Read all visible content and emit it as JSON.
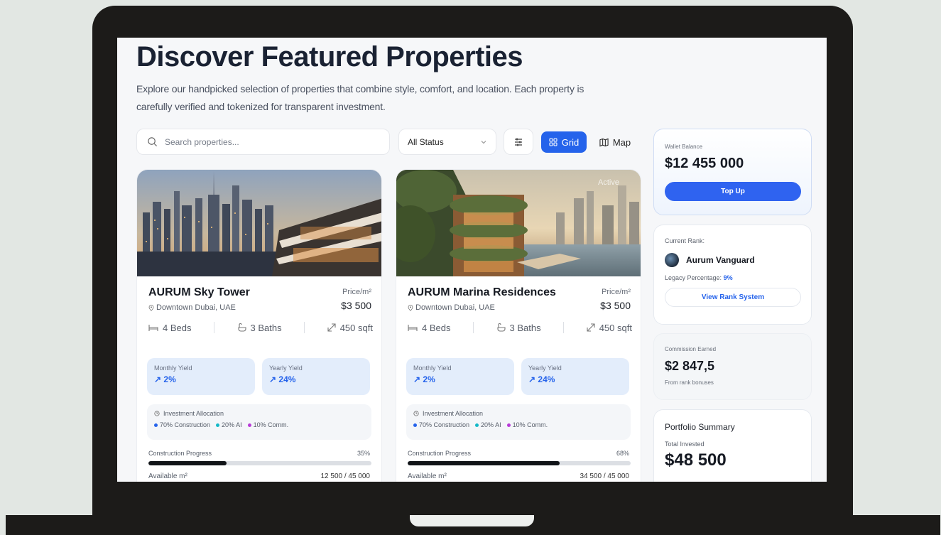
{
  "page": {
    "title": "Discover Featured Properties",
    "subtitle": "Explore our handpicked selection of properties that combine style, comfort, and location. Each property is carefully verified and tokenized for transparent investment."
  },
  "toolbar": {
    "search_placeholder": "Search properties...",
    "status_value": "All Status",
    "grid_label": "Grid",
    "map_label": "Map"
  },
  "cards": [
    {
      "name": "AURUM Sky Tower",
      "location": "Downtown Dubai, UAE",
      "price_label": "Price/m²",
      "price": "$3 500",
      "beds": "4 Beds",
      "baths": "3 Baths",
      "area": "450 sqft",
      "monthly_label": "Monthly Yield",
      "monthly_value": "2%",
      "yearly_label": "Yearly Yield",
      "yearly_value": "24%",
      "alloc_title": "Investment Allocation",
      "alloc_construction": "70% Construction",
      "alloc_ai": "20% AI",
      "alloc_comm": "10% Comm.",
      "progress_label": "Construction Progress",
      "progress_pct": "35%",
      "progress": 0.35,
      "available_label": "Available m²",
      "available_value": "12 500 / 45 000"
    },
    {
      "name": "AURUM Marina Residences",
      "location": "Downtown Dubai, UAE",
      "badge": "Active",
      "price_label": "Price/m²",
      "price": "$3 500",
      "beds": "4 Beds",
      "baths": "3 Baths",
      "area": "450 sqft",
      "monthly_label": "Monthly Yield",
      "monthly_value": "2%",
      "yearly_label": "Yearly Yield",
      "yearly_value": "24%",
      "alloc_title": "Investment Allocation",
      "alloc_construction": "70% Construction",
      "alloc_ai": "20% AI",
      "alloc_comm": "10% Comm.",
      "progress_label": "Construction Progress",
      "progress_pct": "68%",
      "progress": 0.68,
      "available_label": "Available m²",
      "available_value": "34 500 / 45 000"
    }
  ],
  "sidebar": {
    "wallet_label": "Wallet Balance",
    "wallet_amount": "$12 455 000",
    "topup_label": "Top Up",
    "rank_label": "Current Rank:",
    "rank_name": "Aurum Vanguard",
    "legacy_label": "Legacy Percentage:",
    "legacy_value": "9%",
    "rank_button": "View Rank System",
    "commission_label": "Commission Earned",
    "commission_amount": "$2 847,5",
    "commission_note": "From rank bonuses",
    "portfolio_title": "Portfolio Summary",
    "portfolio_sub": "Total Invested",
    "portfolio_amount": "$48 500"
  },
  "colors": {
    "accent": "#2563eb",
    "alloc_construction": "#2563eb",
    "alloc_ai": "#14b8c8",
    "alloc_comm": "#b83ad8"
  }
}
